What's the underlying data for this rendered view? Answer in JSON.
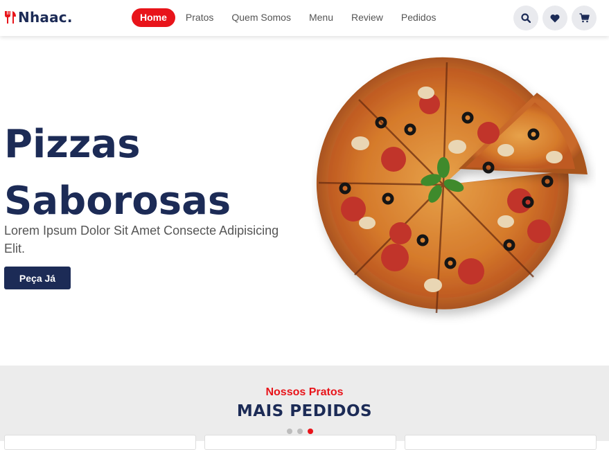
{
  "brand": {
    "name": "Nhaac."
  },
  "nav": {
    "items": [
      {
        "label": "Home",
        "active": true
      },
      {
        "label": "Pratos"
      },
      {
        "label": "Quem Somos"
      },
      {
        "label": "Menu"
      },
      {
        "label": "Review"
      },
      {
        "label": "Pedidos"
      }
    ]
  },
  "header_icons": [
    "search-icon",
    "heart-icon",
    "cart-icon"
  ],
  "hero": {
    "title_line1": "Pizzas",
    "title_line2": "Saborosas",
    "subtitle": "Lorem Ipsum Dolor Sit Amet Consecte Adipisicing Elit.",
    "cta": "Peça Já"
  },
  "section": {
    "kicker": "Nossos Pratos",
    "title": "MAIS PEDIDOS",
    "carousel_dots": 3,
    "active_dot": 3
  },
  "colors": {
    "brand_navy": "#1c2b56",
    "accent_red": "#e8141a",
    "section_bg": "#ececec"
  }
}
